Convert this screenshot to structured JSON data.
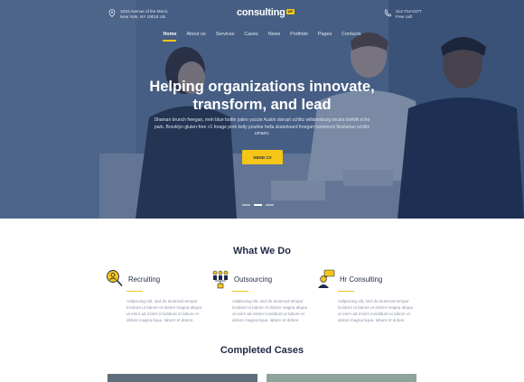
{
  "header": {
    "address_lines": [
      "1010 Avenue of the Moon,",
      "New York, NY 10018 US."
    ],
    "logo_text": "consulting",
    "logo_badge": "WP",
    "phone_lines": [
      "212-714-0177",
      "Free call"
    ]
  },
  "nav": {
    "items": [
      "Home",
      "About us",
      "Services",
      "Cases",
      "News",
      "Portfolio",
      "Pages",
      "Contacts"
    ],
    "active_index": 0
  },
  "hero": {
    "headline_line1": "Helping organizations innovate,",
    "headline_line2": "transform, and lead",
    "subtext": "Shaman brunch freegan, meh blue bottle paleo yuccie Austin disrupt schlitz williamsburg neutra kinfolk echo park. Brooklyn gluten-free +1 forage pork belly poutine hella skateboard freegan hammock flexitarian schlitz umami.",
    "cta_label": "SEND CV",
    "slides_count": 3,
    "active_slide": 1
  },
  "what_we_do": {
    "title": "What We Do",
    "services": [
      {
        "title": "Recruiting",
        "icon": "recruiting-icon",
        "description": "Adipiscing elit, sed do eiusmod tempor incidunt ut labore et dolore magna aliqua ut enim ad minim incididunt ut labore et dolore magna liqua. labore et dolore"
      },
      {
        "title": "Outsourcing",
        "icon": "outsourcing-icon",
        "description": "Adipiscing elit, sed do eiusmod tempor incidunt ut labore et dolore magna aliqua ut enim ad minim incididunt ut labore et dolore magna liqua. labore et dolore"
      },
      {
        "title": "Hr Consulting",
        "icon": "hr-consulting-icon",
        "description": "Adipiscing elit, sed do eiusmod tempor incidunt ut labore et dolore magna aliqua ut enim ad minim incididunt ut labore et dolore magna liqua. labore et dolore"
      }
    ]
  },
  "completed_cases": {
    "title": "Completed Cases"
  },
  "colors": {
    "accent": "#f5c518",
    "navy": "#1f2a44",
    "muted": "#8a93a6"
  }
}
